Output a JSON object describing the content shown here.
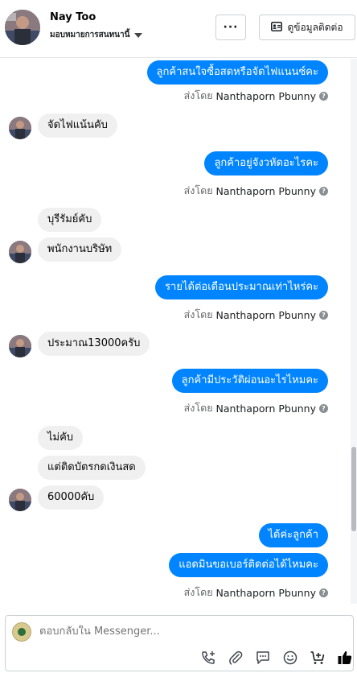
{
  "header": {
    "name": "Nay Too",
    "assign_label": "มอบหมายการสนทนานี้",
    "more_label": "···",
    "info_label": "ดูข้อมูลติดต่อ"
  },
  "sent_by": {
    "prefix": "ส่งโดย",
    "agent": "Nanthaporn Pbunny"
  },
  "messages": [
    {
      "dir": "out",
      "text": "ลูกค้าสนใจซื้อสดหรือจัดไฟแนนซ์คะ"
    },
    {
      "dir": "in",
      "text": "จัดไฟแน้นคับ"
    },
    {
      "dir": "out",
      "text": "ลูกค้าอยู่จังวหัดอะไรคะ"
    },
    {
      "dir": "in",
      "text": "บุรีรัมย์คับ"
    },
    {
      "dir": "in",
      "text": "พนักงานบริษัท"
    },
    {
      "dir": "out",
      "text": "รายได้ต่อเดือนประมาณเท่าไหร่คะ"
    },
    {
      "dir": "in",
      "text": "ประมาณ13000ครับ"
    },
    {
      "dir": "out",
      "text": "ลูกค้ามีประวัติผ่อนอะไรไหมคะ"
    },
    {
      "dir": "in",
      "text": "ไม่คับ"
    },
    {
      "dir": "in",
      "text": "แต่ติดบัตรกดเงินสด"
    },
    {
      "dir": "in",
      "text": "60000คับ"
    },
    {
      "dir": "out",
      "text": "ได้ค่ะลูกค้า"
    },
    {
      "dir": "out",
      "text": "แอดมินขอเบอร์ติดต่อได้ไหมคะ"
    }
  ],
  "composer": {
    "placeholder": "ตอบกลับใน Messenger..."
  },
  "icons": {
    "phone": "phone-plus-icon",
    "attach": "paperclip-icon",
    "saved_reply": "chat-bubble-icon",
    "emoji": "emoji-icon",
    "cart": "cart-plus-icon",
    "like": "thumbs-up-icon"
  },
  "colors": {
    "outgoing_bubble": "#0084ff",
    "incoming_bubble": "#f0f0f0"
  }
}
